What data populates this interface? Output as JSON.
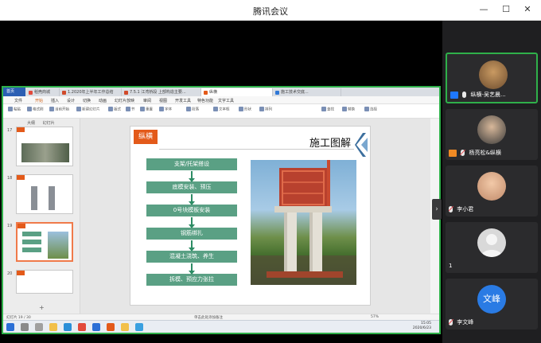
{
  "window": {
    "title": "腾讯会议"
  },
  "wps": {
    "home_tab": "首页",
    "tabs": [
      {
        "label": "稻壳商城",
        "color": "#e24a3b"
      },
      {
        "label": "1.2020年上半年工作总结",
        "color": "#d04a2b"
      },
      {
        "label": "7.5.1 江湾桥段 上部构造主要...",
        "color": "#d04a2b"
      },
      {
        "label": "纵横",
        "color": "#e35a1a"
      },
      {
        "label": "施工技术交底...",
        "color": "#2f78d6"
      }
    ],
    "menu": [
      "文件",
      "开始",
      "插入",
      "设计",
      "切换",
      "动画",
      "幻灯片放映",
      "审阅",
      "视图",
      "开发工具",
      "特色功能",
      "文字工具"
    ],
    "ribbon": [
      "粘贴",
      "格式刷",
      "当前开始",
      "新建幻灯片",
      "版式",
      "节",
      "重置",
      "字体",
      "段落",
      "文本框",
      "形状",
      "排列",
      "查找",
      "替换",
      "选择"
    ],
    "thumb_panel": {
      "tabs": [
        "大纲",
        "幻灯片"
      ],
      "slide_numbers": [
        "17",
        "18",
        "19",
        "20"
      ]
    },
    "status": {
      "left": "幻灯片 19 / 30",
      "zoom": "57%",
      "notes": "单击此处添加备注"
    }
  },
  "slide": {
    "badge": "纵横",
    "title": "施工图解",
    "steps": [
      "支架/托架搭设",
      "底模安装、预压",
      "0号块模板安装",
      "钢筋绑扎",
      "混凝土浇筑、养生",
      "拆模、预应力张拉"
    ],
    "colors": {
      "step": "#5aa084",
      "arrow": "#2c8c64",
      "badge": "#e35a1a"
    }
  },
  "taskbar": {
    "time": "15:05",
    "date": "2020/6/23"
  },
  "participants": [
    {
      "name": "纵横-吴艺晨...",
      "role": "host",
      "mic": "on"
    },
    {
      "name": "杨亮松&纵横",
      "role": "cohost",
      "mic": "off"
    },
    {
      "name": "李小君",
      "role": "",
      "mic": "off"
    },
    {
      "name": "1",
      "role": "",
      "mic": "none"
    },
    {
      "name": "李文峰",
      "role": "",
      "mic": "off",
      "avatar_text": "文峰"
    }
  ]
}
